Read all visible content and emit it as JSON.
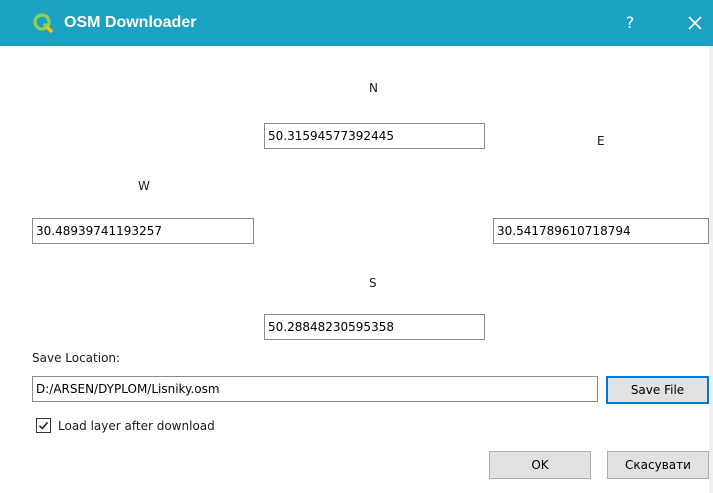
{
  "window": {
    "title": "OSM Downloader",
    "help_label": "?",
    "accent_color": "#1ba1c2"
  },
  "icons": {
    "app": "qgis-icon",
    "close": "close-icon",
    "checkbox": "checkmark-icon"
  },
  "labels": {
    "north": "N",
    "east": "E",
    "west": "W",
    "south": "S",
    "save_location": "Save Location:"
  },
  "fields": {
    "north_value": "50.31594577392445",
    "west_value": "30.48939741193257",
    "east_value": "30.541789610718794",
    "south_value": "50.28848230595358",
    "save_path": "D:/ARSEN/DYPLOM/Lisniky.osm"
  },
  "buttons": {
    "save_file": "Save File",
    "ok": "OK",
    "cancel": "Скасувати"
  },
  "checkbox": {
    "label": "Load layer after download",
    "checked": true
  }
}
